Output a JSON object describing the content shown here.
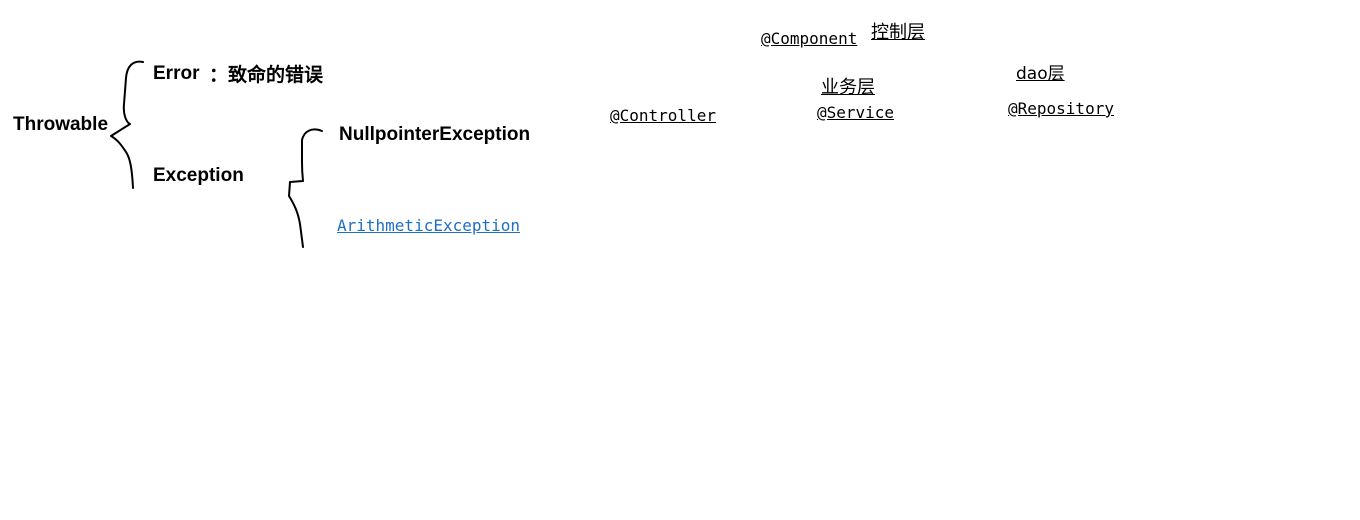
{
  "exception_tree": {
    "root": "Throwable",
    "branch_error": "Error",
    "branch_error_note": "：致命的错误",
    "branch_exception": "Exception",
    "sub_nullpointer": "NullpointerException",
    "sub_arithmetic": "ArithmeticException"
  },
  "spring_layers": {
    "component_annotation": "@Component",
    "component_layer": "控制层",
    "controller_annotation": "@Controller",
    "service_layer": "业务层",
    "service_annotation": "@Service",
    "dao_layer": "dao层",
    "repository_annotation": "@Repository"
  },
  "colors": {
    "text": "#000000",
    "link": "#1f6fc5"
  }
}
